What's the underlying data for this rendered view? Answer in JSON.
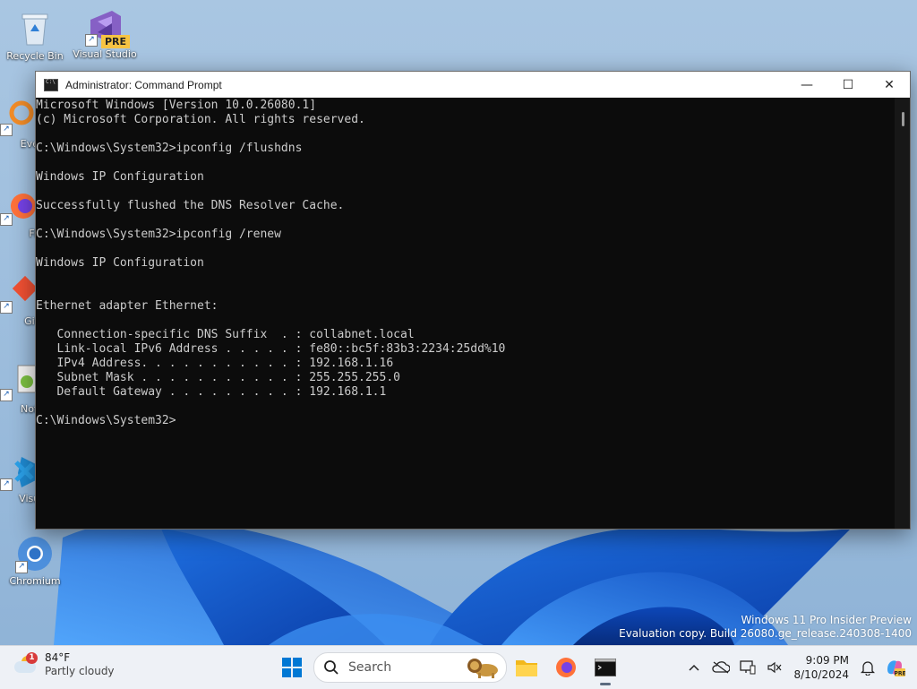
{
  "desktop": {
    "icons": [
      {
        "label": "Recycle Bin"
      },
      {
        "label": "Visual Studio",
        "badge": "PRE"
      },
      {
        "label": "Every"
      },
      {
        "label": "Fire"
      },
      {
        "label": "Git B"
      },
      {
        "label": "Notep"
      },
      {
        "label": "Visual"
      },
      {
        "label": "Chromium"
      }
    ],
    "watermark": {
      "line1": "Windows 11 Pro Insider Preview",
      "line2": "Evaluation copy. Build 26080.ge_release.240308-1400"
    }
  },
  "window": {
    "title": "Administrator: Command Prompt",
    "controls": {
      "minimize": "—",
      "maximize": "☐",
      "close": "✕"
    },
    "console_lines": [
      "Microsoft Windows [Version 10.0.26080.1]",
      "(c) Microsoft Corporation. All rights reserved.",
      "",
      "C:\\Windows\\System32>ipconfig /flushdns",
      "",
      "Windows IP Configuration",
      "",
      "Successfully flushed the DNS Resolver Cache.",
      "",
      "C:\\Windows\\System32>ipconfig /renew",
      "",
      "Windows IP Configuration",
      "",
      "",
      "Ethernet adapter Ethernet:",
      "",
      "   Connection-specific DNS Suffix  . : collabnet.local",
      "   Link-local IPv6 Address . . . . . : fe80::bc5f:83b3:2234:25dd%10",
      "   IPv4 Address. . . . . . . . . . . : 192.168.1.16",
      "   Subnet Mask . . . . . . . . . . . : 255.255.255.0",
      "   Default Gateway . . . . . . . . . : 192.168.1.1",
      "",
      "C:\\Windows\\System32>"
    ]
  },
  "taskbar": {
    "weather": {
      "temp": "84°F",
      "condition": "Partly cloudy",
      "alert_count": "1"
    },
    "search_label": "Search",
    "clock": {
      "time": "9:09 PM",
      "date": "8/10/2024"
    },
    "apps": [
      "file-explorer",
      "firefox",
      "command-prompt"
    ]
  },
  "colors": {
    "console_bg": "#0c0c0c",
    "console_fg": "#cccccc",
    "taskbar_bg": "#eef1f6",
    "accent": "#0067c0"
  }
}
